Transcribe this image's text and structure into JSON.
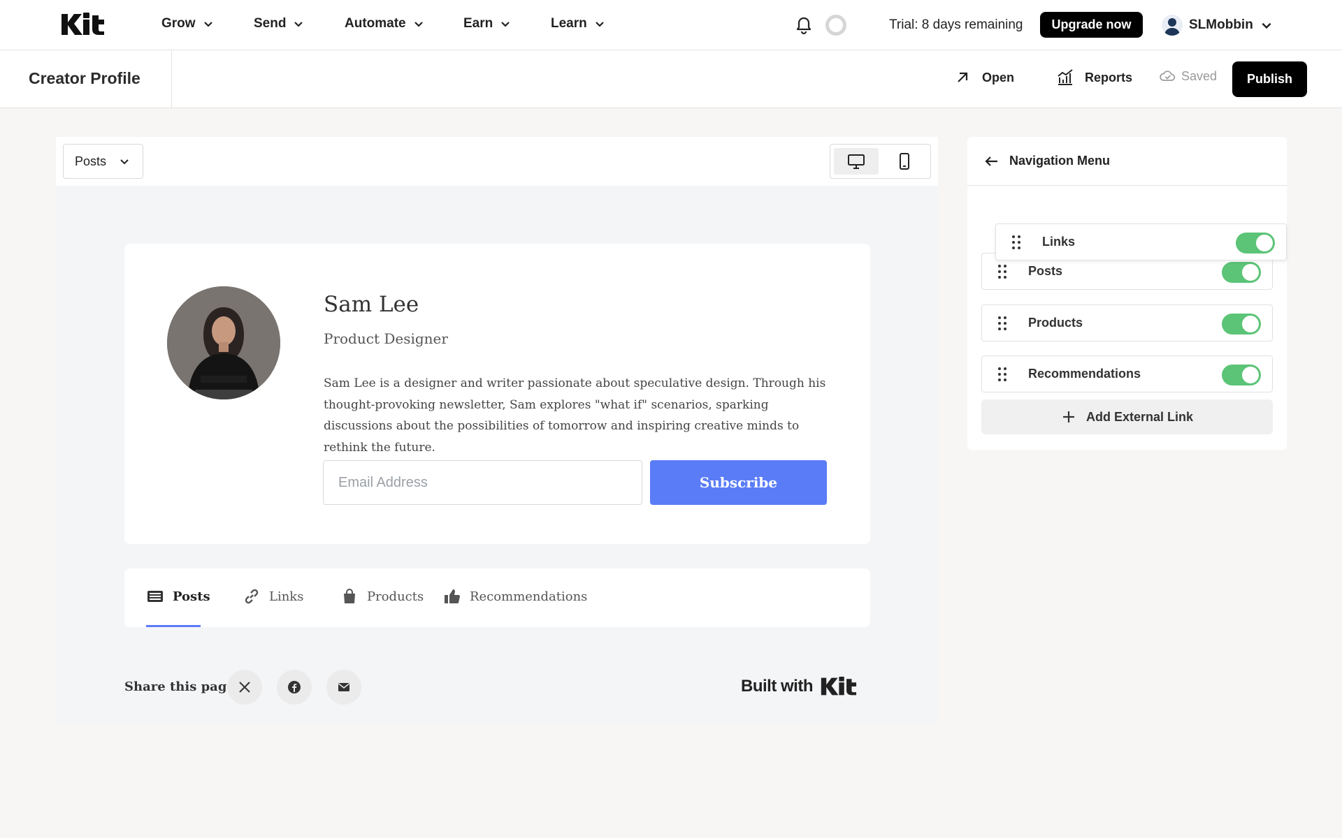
{
  "topnav": {
    "logo": "Kit",
    "items": [
      {
        "label": "Grow"
      },
      {
        "label": "Send"
      },
      {
        "label": "Automate"
      },
      {
        "label": "Earn"
      },
      {
        "label": "Learn"
      }
    ],
    "trial_text": "Trial: 8 days remaining",
    "upgrade_label": "Upgrade now",
    "username": "SLMobbin"
  },
  "subbar": {
    "title": "Creator Profile",
    "open_label": "Open",
    "reports_label": "Reports",
    "saved_label": "Saved",
    "publish_label": "Publish"
  },
  "preview": {
    "page_select": "Posts",
    "profile": {
      "name": "Sam Lee",
      "role": "Product Designer",
      "bio": "Sam Lee is a designer and writer passionate about speculative design. Through his thought-provoking newsletter, Sam explores \"what if\" scenarios, sparking discussions about the possibilities of tomorrow and inspiring creative minds to rethink the future.",
      "email_placeholder": "Email Address",
      "subscribe_label": "Subscribe"
    },
    "tabs": [
      {
        "label": "Posts",
        "icon": "newspaper-icon"
      },
      {
        "label": "Links",
        "icon": "link-icon"
      },
      {
        "label": "Products",
        "icon": "shopping-bag-icon"
      },
      {
        "label": "Recommendations",
        "icon": "thumbs-up-icon"
      }
    ],
    "share_label": "Share this page",
    "built_with": "Built with",
    "built_logo": "Kit"
  },
  "nav_panel": {
    "title": "Navigation Menu",
    "items": [
      {
        "label": "Links",
        "enabled": true
      },
      {
        "label": "Posts",
        "enabled": true
      },
      {
        "label": "Products",
        "enabled": true
      },
      {
        "label": "Recommendations",
        "enabled": true
      }
    ],
    "add_label": "Add External Link"
  },
  "colors": {
    "accent": "#5b7cf7",
    "toggle_on": "#5bc477",
    "primary_button": "#000000"
  }
}
